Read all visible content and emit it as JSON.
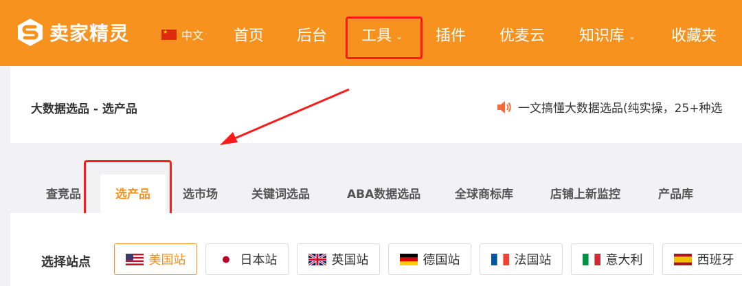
{
  "brand": {
    "name": "卖家精灵"
  },
  "lang": {
    "label": "中文",
    "caret": "·"
  },
  "nav": [
    {
      "label": "首页",
      "caret": ""
    },
    {
      "label": "后台",
      "caret": ""
    },
    {
      "label": "工具",
      "caret": "⌄"
    },
    {
      "label": "插件",
      "caret": ""
    },
    {
      "label": "优麦云",
      "caret": ""
    },
    {
      "label": "知识库",
      "caret": "⌄"
    },
    {
      "label": "收藏夹",
      "caret": ""
    }
  ],
  "header": {
    "title": "大数据选品 - 选产品",
    "notice": "一文搞懂大数据选品(纯实操，25+种选"
  },
  "tabs": [
    {
      "label": "查竞品"
    },
    {
      "label": "选产品"
    },
    {
      "label": "选市场"
    },
    {
      "label": "关键词选品"
    },
    {
      "label": "ABA数据选品"
    },
    {
      "label": "全球商标库"
    },
    {
      "label": "店铺上新监控"
    },
    {
      "label": "产品库"
    }
  ],
  "sites": {
    "label": "选择站点",
    "items": [
      {
        "label": "美国站",
        "flag": "us-flag-icon"
      },
      {
        "label": "日本站",
        "flag": "jp-flag-icon"
      },
      {
        "label": "英国站",
        "flag": "uk-flag-icon"
      },
      {
        "label": "德国站",
        "flag": "de-flag-icon"
      },
      {
        "label": "法国站",
        "flag": "fr-flag-icon"
      },
      {
        "label": "意大利",
        "flag": "it-flag-icon"
      },
      {
        "label": "西班牙",
        "flag": "es-flag-icon"
      }
    ],
    "selected": "美国站"
  },
  "colors": {
    "accent": "#f7921e",
    "annotation": "#ff1a1a",
    "page_bg": "#f2f2f4"
  }
}
